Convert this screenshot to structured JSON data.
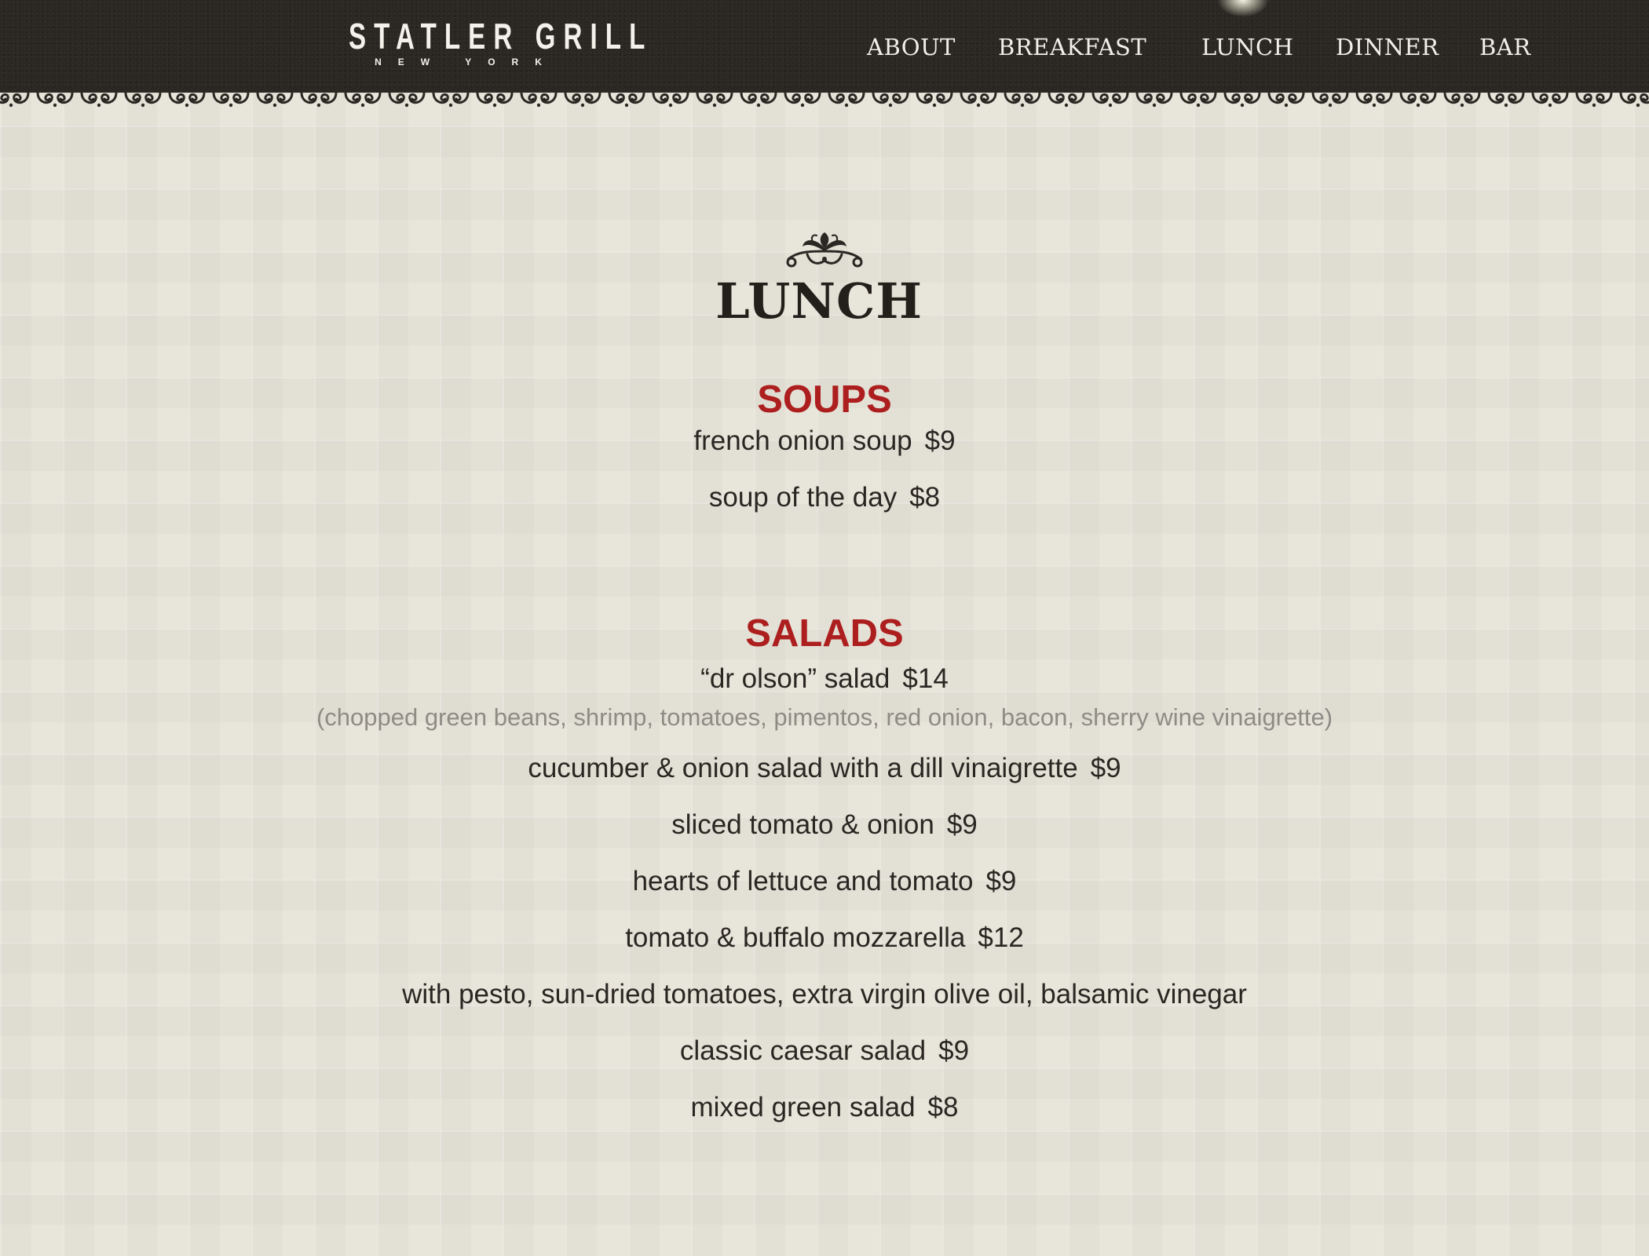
{
  "brand": {
    "name": "STATLER GRILL",
    "location": "NEW YORK"
  },
  "nav": {
    "items": [
      {
        "label": "ABOUT"
      },
      {
        "label": "BREAKFAST"
      },
      {
        "label": "LUNCH",
        "active": true
      },
      {
        "label": "DINNER"
      },
      {
        "label": "BAR"
      }
    ]
  },
  "menu": {
    "title": "LUNCH",
    "ornament_icon": "floral-ornament-icon",
    "sections": [
      {
        "title": "SOUPS",
        "items": [
          {
            "name": "french onion soup",
            "price": "$9"
          },
          {
            "name": "soup of the day",
            "price": "$8"
          }
        ]
      },
      {
        "title": "SALADS",
        "items": [
          {
            "name": "“dr olson” salad",
            "price": "$14",
            "description": "(chopped green beans, shrimp, tomatoes, pimentos, red onion, bacon, sherry wine vinaigrette)"
          },
          {
            "name": "cucumber & onion salad with a dill vinaigrette",
            "price": "$9"
          },
          {
            "name": "sliced tomato & onion",
            "price": "$9"
          },
          {
            "name": "hearts of lettuce and tomato",
            "price": "$9"
          },
          {
            "name": "tomato & buffalo mozzarella",
            "price": "$12"
          },
          {
            "name": "with pesto, sun-dried tomatoes, extra virgin olive oil, balsamic vinegar",
            "price": ""
          },
          {
            "name": "classic caesar salad",
            "price": "$9"
          },
          {
            "name": "mixed green salad",
            "price": "$8"
          }
        ]
      }
    ]
  },
  "colors": {
    "header_bg": "#2b2723",
    "page_bg": "#e8e5da",
    "section_title": "#ad1f1f",
    "item_text": "#2a2622",
    "description_text": "#8f8b85"
  }
}
